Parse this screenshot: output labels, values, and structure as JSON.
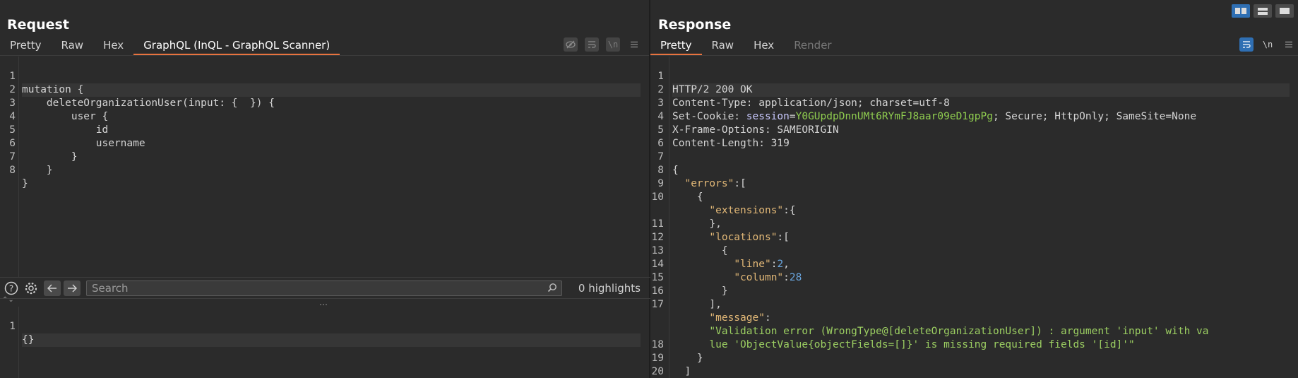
{
  "request": {
    "title": "Request",
    "tabs": [
      {
        "label": "Pretty"
      },
      {
        "label": "Raw"
      },
      {
        "label": "Hex"
      },
      {
        "label": "GraphQL (InQL - GraphQL Scanner)"
      }
    ],
    "query_lines": [
      {
        "n": "1",
        "text": "mutation {"
      },
      {
        "n": "2",
        "text": "    deleteOrganizationUser(input: {  }) {"
      },
      {
        "n": "3",
        "text": "        user {"
      },
      {
        "n": "4",
        "text": "            id"
      },
      {
        "n": "5",
        "text": "            username"
      },
      {
        "n": "6",
        "text": "        }"
      },
      {
        "n": "7",
        "text": "    }"
      },
      {
        "n": "8",
        "text": "}"
      }
    ],
    "search": {
      "placeholder": "Search",
      "highlights": "0 highlights"
    },
    "variables_lines": [
      {
        "n": "1",
        "text": "{}"
      }
    ]
  },
  "response": {
    "title": "Response",
    "tabs": [
      {
        "label": "Pretty"
      },
      {
        "label": "Raw"
      },
      {
        "label": "Hex"
      },
      {
        "label": "Render"
      }
    ],
    "icons": {
      "wrap": "\\n"
    },
    "status_line": "HTTP/2 200 OK",
    "headers": {
      "content_type_name": "Content-Type:",
      "content_type_value": " application/json; charset=utf-8",
      "set_cookie_name": "Set-Cookie:",
      "cookie_name": "session",
      "cookie_value": "Y0GUpdpDnnUMt6RYmFJ8aar09eD1gpPg",
      "cookie_attrs": "; Secure; HttpOnly; SameSite=None",
      "xfo_name": "X-Frame-Options:",
      "xfo_value": " SAMEORIGIN",
      "cl_name": "Content-Length:",
      "cl_value": " 319"
    },
    "body": {
      "errors_key": "\"errors\"",
      "extensions_key": "\"extensions\"",
      "locations_key": "\"locations\"",
      "line_key": "\"line\"",
      "line_value": "2",
      "column_key": "\"column\"",
      "column_value": "28",
      "message_key": "\"message\"",
      "message_part1": "\"Validation error (WrongType@[deleteOrganizationUser]) : argument 'input' with va",
      "message_part2": "lue 'ObjectValue{objectFields=[]}' is missing required fields '[id]'\""
    },
    "line_numbers": [
      "1",
      "2",
      "3",
      "4",
      "5",
      "6",
      "7",
      "8",
      "9",
      "10",
      "11",
      "12",
      "13",
      "14",
      "15",
      "16",
      "17",
      "18",
      "19",
      "20"
    ]
  }
}
